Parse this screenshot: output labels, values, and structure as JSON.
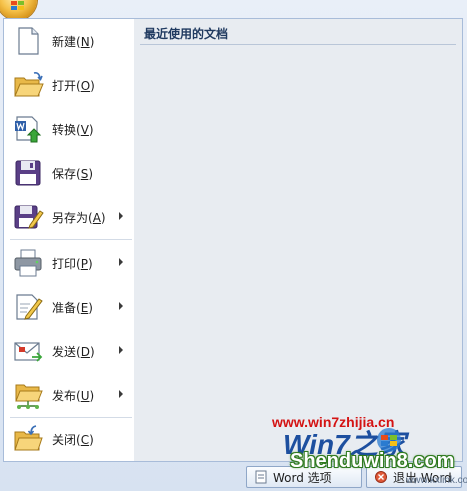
{
  "menu": {
    "items": [
      {
        "label": "新建",
        "key": "N"
      },
      {
        "label": "打开",
        "key": "O"
      },
      {
        "label": "转换",
        "key": "V"
      },
      {
        "label": "保存",
        "key": "S"
      },
      {
        "label": "另存为",
        "key": "A"
      },
      {
        "label": "打印",
        "key": "P"
      },
      {
        "label": "准备",
        "key": "E"
      },
      {
        "label": "发送",
        "key": "D"
      },
      {
        "label": "发布",
        "key": "U"
      },
      {
        "label": "关闭",
        "key": "C"
      }
    ]
  },
  "recent": {
    "title": "最近使用的文档"
  },
  "bottom": {
    "options_label": "Word 选项",
    "exit_label": "退出 Word"
  },
  "watermark": {
    "url": "www.win7zhijia.cn",
    "logo_text": "Win7之家",
    "shendu": "Shenduwin8.com",
    "kxlink": "www.kxlink.com"
  },
  "colors": {
    "accent": "#203a60",
    "border": "#a8bcd9",
    "recent_bg": "#e8ecf1"
  }
}
